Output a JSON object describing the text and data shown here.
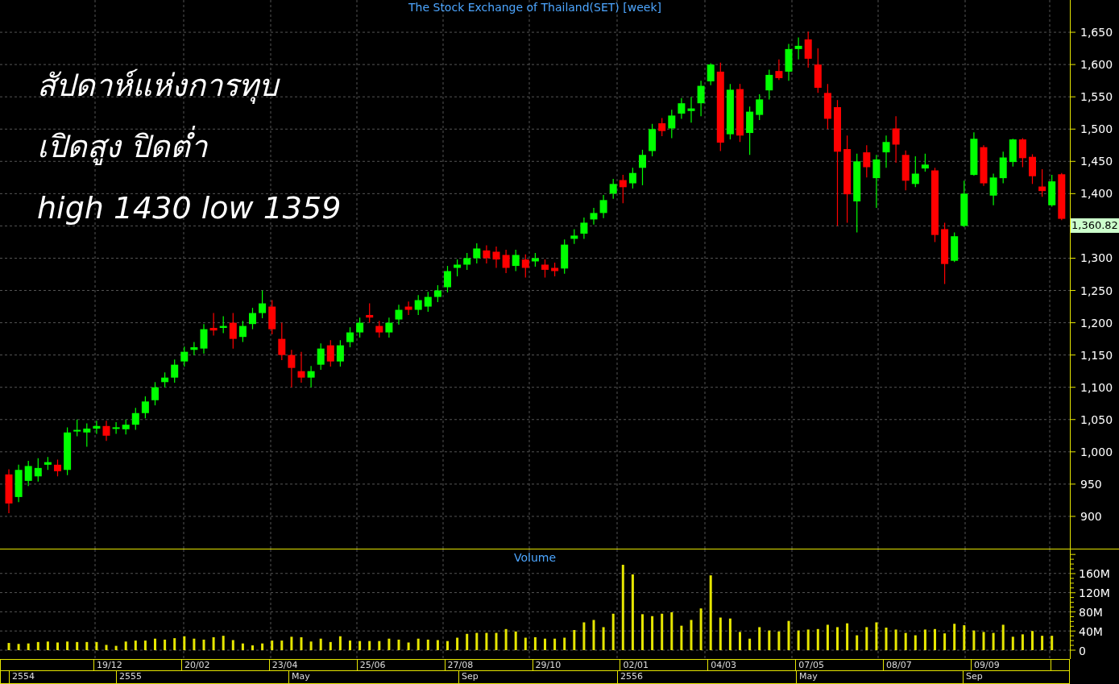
{
  "annotation_lines": [
    "สัปดาห์แห่งการทุบ",
    "เปิดสูง ปิดต่ำ",
    "high 1430 low 1359"
  ],
  "price_chart": {
    "last_price": "1,360.82",
    "chart_data": {
      "type": "candlestick",
      "title": "The Stock Exchange of Thailand(SET) [week]",
      "ylim": [
        850,
        1700
      ],
      "grid": true,
      "categories": [
        null,
        null,
        null,
        null,
        null,
        null,
        null,
        null,
        null,
        null,
        null,
        null,
        null,
        null,
        null,
        null,
        null,
        null,
        null,
        null,
        null,
        null,
        null,
        null,
        null,
        null,
        null,
        null,
        null,
        null,
        null,
        null,
        null,
        null,
        null,
        null,
        null,
        null,
        null,
        null,
        null,
        null,
        null,
        null,
        null,
        null,
        null,
        null,
        null,
        null,
        null,
        null,
        null,
        null,
        null,
        null,
        null,
        null,
        null,
        null,
        null,
        null,
        null,
        null,
        null,
        null,
        null,
        null,
        null,
        null,
        null,
        null,
        null,
        null,
        null,
        null,
        null,
        null,
        null,
        null,
        null,
        null,
        null,
        null,
        null,
        null,
        null,
        null,
        null,
        null,
        null,
        null,
        null,
        null,
        null,
        null,
        null,
        null,
        null,
        null,
        null,
        null,
        null,
        null,
        null,
        null,
        null,
        null,
        null
      ],
      "yticks": [
        {
          "value": 1650,
          "label": "1,650"
        },
        {
          "value": 1600,
          "label": "1,600"
        },
        {
          "value": 1550,
          "label": "1,550"
        },
        {
          "value": 1500,
          "label": "1,500"
        },
        {
          "value": 1450,
          "label": "1,450"
        },
        {
          "value": 1400,
          "label": "1,400"
        },
        {
          "value": 1300,
          "label": "1,300"
        },
        {
          "value": 1250,
          "label": "1,250"
        },
        {
          "value": 1200,
          "label": "1,200"
        },
        {
          "value": 1150,
          "label": "1,150"
        },
        {
          "value": 1100,
          "label": "1,100"
        },
        {
          "value": 1050,
          "label": "1,050"
        },
        {
          "value": 1000,
          "label": "1,000"
        },
        {
          "value": 950,
          "label": "950"
        },
        {
          "value": 900,
          "label": "900"
        }
      ],
      "ohlc": [
        [
          965,
          973,
          905,
          920
        ],
        [
          930,
          980,
          922,
          972
        ],
        [
          955,
          986,
          947,
          978
        ],
        [
          962,
          990,
          954,
          975
        ],
        [
          980,
          992,
          972,
          984
        ],
        [
          980,
          988,
          962,
          970
        ],
        [
          972,
          1038,
          964,
          1030
        ],
        [
          1032,
          1050,
          1024,
          1034
        ],
        [
          1030,
          1044,
          1008,
          1036
        ],
        [
          1036,
          1048,
          1028,
          1040
        ],
        [
          1040,
          1048,
          1017,
          1025
        ],
        [
          1036,
          1046,
          1028,
          1038
        ],
        [
          1035,
          1050,
          1027,
          1042
        ],
        [
          1042,
          1068,
          1034,
          1060
        ],
        [
          1060,
          1086,
          1052,
          1078
        ],
        [
          1080,
          1108,
          1072,
          1100
        ],
        [
          1108,
          1123,
          1100,
          1115
        ],
        [
          1115,
          1143,
          1107,
          1135
        ],
        [
          1140,
          1163,
          1132,
          1155
        ],
        [
          1158,
          1170,
          1150,
          1162
        ],
        [
          1160,
          1198,
          1152,
          1190
        ],
        [
          1192,
          1215,
          1180,
          1188
        ],
        [
          1192,
          1210,
          1184,
          1195
        ],
        [
          1200,
          1215,
          1160,
          1175
        ],
        [
          1178,
          1203,
          1170,
          1195
        ],
        [
          1198,
          1223,
          1190,
          1215
        ],
        [
          1215,
          1250,
          1207,
          1230
        ],
        [
          1225,
          1235,
          1182,
          1190
        ],
        [
          1175,
          1200,
          1142,
          1150
        ],
        [
          1150,
          1158,
          1100,
          1130
        ],
        [
          1125,
          1155,
          1107,
          1115
        ],
        [
          1115,
          1133,
          1100,
          1125
        ],
        [
          1135,
          1168,
          1127,
          1160
        ],
        [
          1165,
          1173,
          1132,
          1140
        ],
        [
          1140,
          1173,
          1132,
          1165
        ],
        [
          1170,
          1193,
          1162,
          1185
        ],
        [
          1185,
          1208,
          1177,
          1200
        ],
        [
          1212,
          1230,
          1200,
          1208
        ],
        [
          1195,
          1203,
          1177,
          1185
        ],
        [
          1185,
          1208,
          1177,
          1200
        ],
        [
          1205,
          1228,
          1197,
          1220
        ],
        [
          1225,
          1233,
          1212,
          1220
        ],
        [
          1220,
          1243,
          1212,
          1235
        ],
        [
          1225,
          1248,
          1217,
          1240
        ],
        [
          1240,
          1258,
          1232,
          1250
        ],
        [
          1255,
          1288,
          1247,
          1280
        ],
        [
          1285,
          1298,
          1272,
          1290
        ],
        [
          1290,
          1308,
          1282,
          1300
        ],
        [
          1300,
          1323,
          1292,
          1315
        ],
        [
          1312,
          1320,
          1292,
          1300
        ],
        [
          1310,
          1318,
          1285,
          1298
        ],
        [
          1305,
          1313,
          1277,
          1285
        ],
        [
          1288,
          1313,
          1280,
          1305
        ],
        [
          1298,
          1306,
          1270,
          1285
        ],
        [
          1295,
          1308,
          1287,
          1300
        ],
        [
          1290,
          1298,
          1270,
          1282
        ],
        [
          1285,
          1293,
          1272,
          1280
        ],
        [
          1284,
          1329,
          1276,
          1321
        ],
        [
          1330,
          1345,
          1322,
          1335
        ],
        [
          1338,
          1363,
          1330,
          1355
        ],
        [
          1360,
          1378,
          1352,
          1370
        ],
        [
          1370,
          1398,
          1362,
          1390
        ],
        [
          1400,
          1423,
          1392,
          1415
        ],
        [
          1421,
          1429,
          1385,
          1410
        ],
        [
          1416,
          1440,
          1408,
          1432
        ],
        [
          1440,
          1468,
          1413,
          1460
        ],
        [
          1466,
          1508,
          1458,
          1500
        ],
        [
          1509,
          1517,
          1489,
          1497
        ],
        [
          1501,
          1530,
          1486,
          1521
        ],
        [
          1524,
          1548,
          1516,
          1540
        ],
        [
          1528,
          1550,
          1510,
          1532
        ],
        [
          1540,
          1575,
          1520,
          1567
        ],
        [
          1574,
          1602,
          1568,
          1600
        ],
        [
          1589,
          1603,
          1466,
          1479
        ],
        [
          1492,
          1570,
          1484,
          1561
        ],
        [
          1562,
          1570,
          1480,
          1490
        ],
        [
          1494,
          1535,
          1460,
          1527
        ],
        [
          1522,
          1554,
          1514,
          1546
        ],
        [
          1560,
          1592,
          1546,
          1584
        ],
        [
          1590,
          1608,
          1576,
          1579
        ],
        [
          1589,
          1632,
          1575,
          1624
        ],
        [
          1624,
          1642,
          1608,
          1629
        ],
        [
          1639,
          1651,
          1595,
          1609
        ],
        [
          1600,
          1625,
          1556,
          1564
        ],
        [
          1556,
          1570,
          1500,
          1516
        ],
        [
          1534,
          1545,
          1350,
          1465
        ],
        [
          1469,
          1490,
          1355,
          1399
        ],
        [
          1388,
          1462,
          1340,
          1450
        ],
        [
          1464,
          1475,
          1425,
          1441
        ],
        [
          1424,
          1460,
          1378,
          1453
        ],
        [
          1464,
          1490,
          1440,
          1480
        ],
        [
          1501,
          1520,
          1448,
          1476
        ],
        [
          1460,
          1467,
          1405,
          1420
        ],
        [
          1415,
          1458,
          1410,
          1431
        ],
        [
          1439,
          1462,
          1434,
          1445
        ],
        [
          1436,
          1440,
          1325,
          1336
        ],
        [
          1345,
          1355,
          1260,
          1291
        ],
        [
          1296,
          1340,
          1294,
          1334
        ],
        [
          1350,
          1420,
          1348,
          1400
        ],
        [
          1429,
          1495,
          1428,
          1485
        ],
        [
          1472,
          1475,
          1412,
          1416
        ],
        [
          1397,
          1431,
          1382,
          1425
        ],
        [
          1424,
          1465,
          1416,
          1456
        ],
        [
          1449,
          1485,
          1442,
          1484
        ],
        [
          1484,
          1486,
          1441,
          1455
        ],
        [
          1457,
          1461,
          1415,
          1427
        ],
        [
          1411,
          1438,
          1395,
          1404
        ],
        [
          1382,
          1429,
          1380,
          1419
        ],
        [
          1430,
          1432,
          1359,
          1361
        ]
      ]
    }
  },
  "volume_chart": {
    "chart_data": {
      "type": "bar",
      "title": "Volume",
      "ylim": [
        0,
        210
      ],
      "grid": true,
      "yticks": [
        {
          "value": 160,
          "label": "160M"
        },
        {
          "value": 120,
          "label": "120M"
        },
        {
          "value": 80,
          "label": "80M"
        },
        {
          "value": 40,
          "label": "40M"
        },
        {
          "value": 0,
          "label": "0"
        }
      ],
      "categories": [
        null,
        null,
        null,
        null,
        null,
        null,
        null,
        null,
        null,
        null,
        "19/12",
        null,
        null,
        null,
        null,
        null,
        null,
        null,
        null,
        "20/02",
        null,
        null,
        null,
        null,
        null,
        null,
        null,
        null,
        "23/04",
        null,
        null,
        null,
        null,
        null,
        null,
        null,
        null,
        "25/06",
        null,
        null,
        null,
        null,
        null,
        null,
        null,
        null,
        "27/08",
        null,
        null,
        null,
        null,
        null,
        null,
        null,
        null,
        "29/10",
        null,
        null,
        null,
        null,
        null,
        null,
        null,
        null,
        "02/01",
        null,
        null,
        null,
        null,
        null,
        null,
        null,
        null,
        "04/03",
        null,
        null,
        null,
        null,
        null,
        null,
        null,
        null,
        "07/05",
        null,
        null,
        null,
        null,
        null,
        null,
        null,
        null,
        "08/07",
        null,
        null,
        null,
        null,
        null,
        null,
        null,
        null,
        "09/09",
        null,
        null,
        null,
        null,
        null,
        null,
        null
      ],
      "values": [
        15,
        13,
        14,
        17,
        18,
        16,
        18,
        17,
        17,
        17,
        11,
        9,
        18,
        20,
        20,
        24,
        22,
        25,
        29,
        24,
        22,
        27,
        30,
        21,
        14,
        10,
        14,
        20,
        20,
        28,
        27,
        18,
        24,
        17,
        29,
        20,
        19,
        19,
        19,
        24,
        22,
        16,
        24,
        22,
        21,
        19,
        26,
        34,
        36,
        36,
        36,
        44,
        39,
        26,
        27,
        24,
        24,
        26,
        42,
        58,
        63,
        48,
        76,
        178,
        158,
        75,
        71,
        76,
        79,
        51,
        63,
        87,
        156,
        68,
        66,
        38,
        24,
        48,
        41,
        39,
        61,
        41,
        43,
        44,
        53,
        48,
        56,
        31,
        48,
        58,
        47,
        43,
        36,
        31,
        43,
        44,
        35,
        55,
        52,
        41,
        38,
        36,
        53,
        28,
        33,
        40,
        30,
        30
      ]
    }
  },
  "period_row": [
    "2554",
    "2555",
    "May",
    "Sep",
    "2556",
    "May",
    "Sep"
  ]
}
